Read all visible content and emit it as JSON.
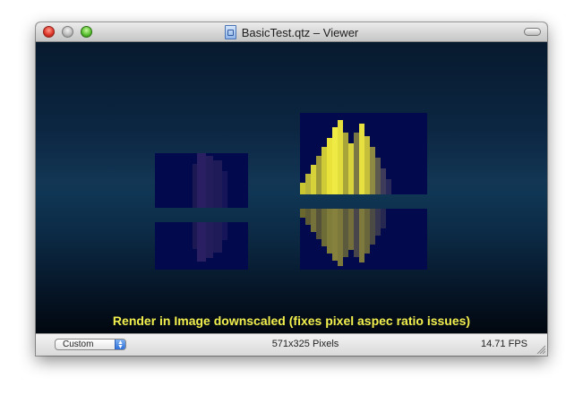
{
  "window": {
    "title": "BasicTest.qtz – Viewer",
    "file_icon": "quartz-composer-document-icon",
    "buttons": [
      "close-button",
      "minimize-button",
      "zoom-button"
    ]
  },
  "viewer": {
    "caption": "Render in Image downscaled (fixes pixel aspec ratio issues)",
    "colors": {
      "caption": "#f3f04e",
      "tile": "#03094d",
      "flame": "#e8e23a"
    }
  },
  "statusbar": {
    "size_popup": {
      "selected": "Custom"
    },
    "resolution": "571x325 Pixels",
    "fps": "14.71 FPS"
  }
}
